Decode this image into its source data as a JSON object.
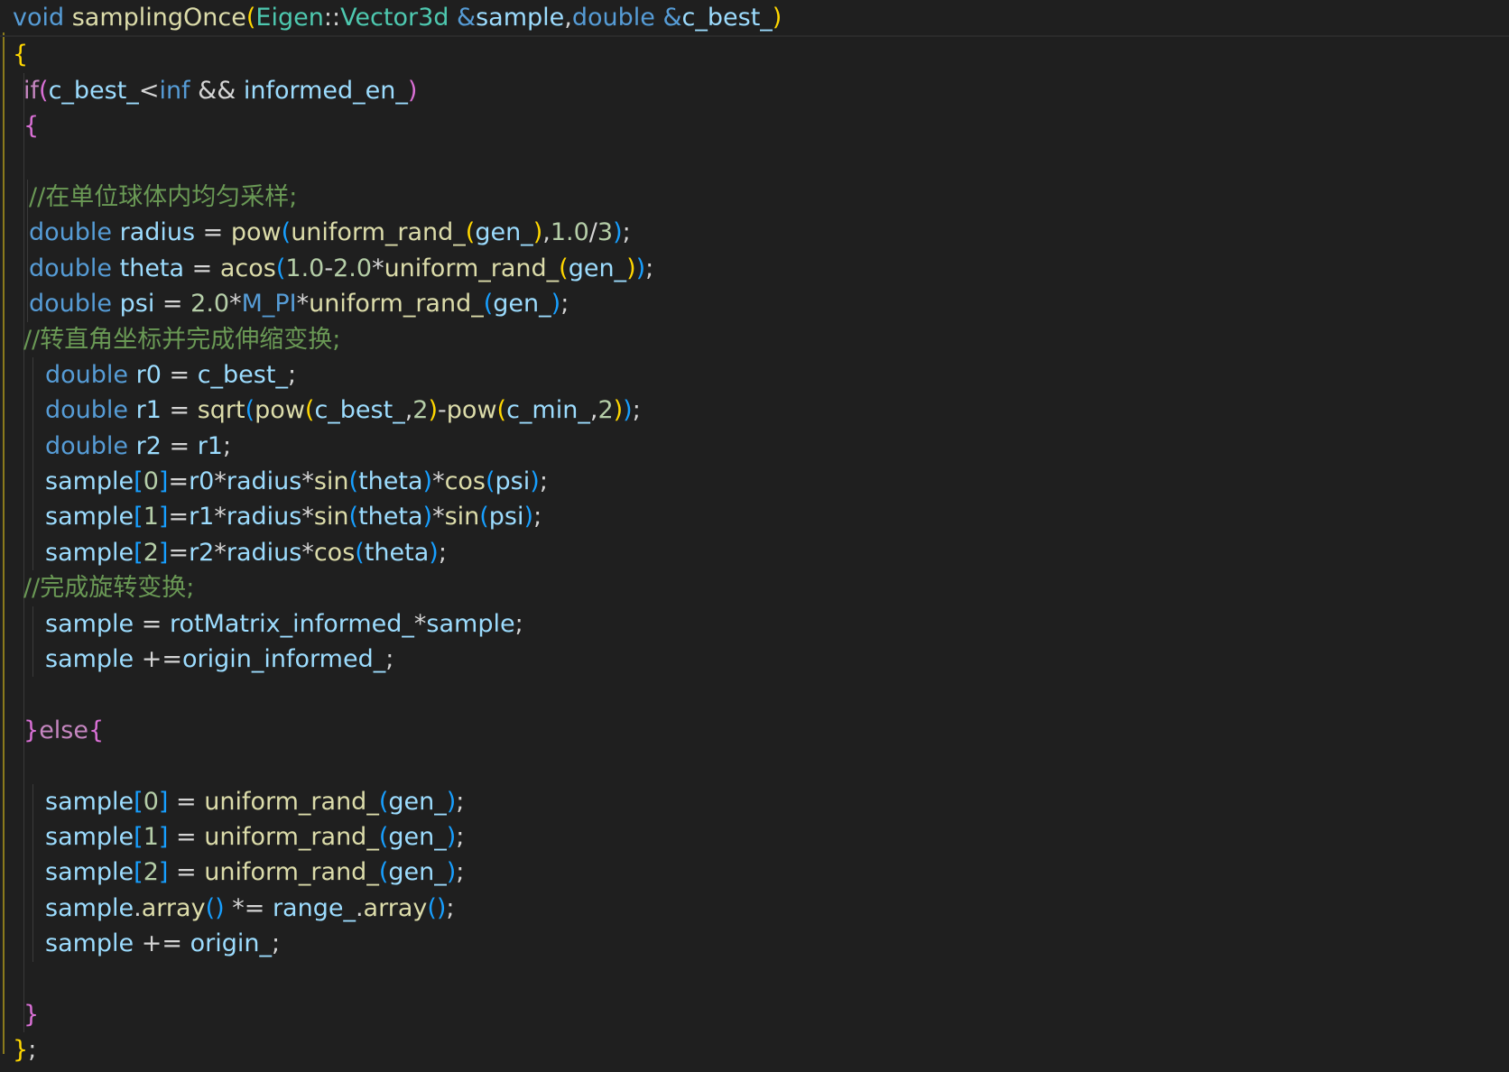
{
  "editor": {
    "language": "cpp",
    "colors": {
      "background": "#1f1f1f",
      "keyword": "#569cd6",
      "control": "#c586c0",
      "function": "#dcdcaa",
      "type": "#4ec9b0",
      "variable": "#9cdcfe",
      "number": "#b5cea8",
      "comment": "#6a9955",
      "bracket_gold": "#ffd700",
      "bracket_orchid": "#da70d6",
      "bracket_blue": "#179fff",
      "plain": "#d4d4d4"
    },
    "lines": [
      {
        "indent": 0,
        "tokens": [
          [
            "t-kw",
            "void"
          ],
          [
            "t-plain",
            " "
          ],
          [
            "t-fn",
            "samplingOnce"
          ],
          [
            "t-br1",
            "("
          ],
          [
            "t-type",
            "Eigen"
          ],
          [
            "t-plain",
            "::"
          ],
          [
            "t-type",
            "Vector3d"
          ],
          [
            "t-plain",
            " "
          ],
          [
            "t-kw",
            "&"
          ],
          [
            "t-var",
            "sample"
          ],
          [
            "t-plain",
            ","
          ],
          [
            "t-kw",
            "double"
          ],
          [
            "t-plain",
            " "
          ],
          [
            "t-kw",
            "&"
          ],
          [
            "t-var",
            "c_best_"
          ],
          [
            "t-br1",
            ")"
          ]
        ]
      },
      {
        "indent": 0,
        "tokens": [
          [
            "t-br1",
            "{"
          ]
        ]
      },
      {
        "indent": 1,
        "tokens": [
          [
            "t-ctl",
            "if"
          ],
          [
            "t-br2",
            "("
          ],
          [
            "t-var",
            "c_best_"
          ],
          [
            "t-plain",
            "<"
          ],
          [
            "t-kw",
            "inf"
          ],
          [
            "t-plain",
            " && "
          ],
          [
            "t-var",
            "informed_en_"
          ],
          [
            "t-br2",
            ")"
          ]
        ]
      },
      {
        "indent": 1,
        "tokens": [
          [
            "t-br2",
            "{"
          ]
        ]
      },
      {
        "indent": 1,
        "tokens": []
      },
      {
        "indent": 2,
        "tokens": [
          [
            "t-cmt",
            "//在单位球体内均匀采样;"
          ]
        ]
      },
      {
        "indent": 2,
        "tokens": [
          [
            "t-kw",
            "double"
          ],
          [
            "t-plain",
            " "
          ],
          [
            "t-var",
            "radius"
          ],
          [
            "t-plain",
            " = "
          ],
          [
            "t-fn",
            "pow"
          ],
          [
            "t-br3",
            "("
          ],
          [
            "t-fn",
            "uniform_rand_"
          ],
          [
            "t-br1",
            "("
          ],
          [
            "t-var",
            "gen_"
          ],
          [
            "t-br1",
            ")"
          ],
          [
            "t-plain",
            ","
          ],
          [
            "t-num",
            "1.0"
          ],
          [
            "t-plain",
            "/"
          ],
          [
            "t-num",
            "3"
          ],
          [
            "t-br3",
            ")"
          ],
          [
            "t-plain",
            ";"
          ]
        ]
      },
      {
        "indent": 2,
        "tokens": [
          [
            "t-kw",
            "double"
          ],
          [
            "t-plain",
            " "
          ],
          [
            "t-var",
            "theta"
          ],
          [
            "t-plain",
            " = "
          ],
          [
            "t-fn",
            "acos"
          ],
          [
            "t-br3",
            "("
          ],
          [
            "t-num",
            "1.0"
          ],
          [
            "t-plain",
            "-"
          ],
          [
            "t-num",
            "2.0"
          ],
          [
            "t-plain",
            "*"
          ],
          [
            "t-fn",
            "uniform_rand_"
          ],
          [
            "t-br1",
            "("
          ],
          [
            "t-var",
            "gen_"
          ],
          [
            "t-br1",
            ")"
          ],
          [
            "t-br3",
            ")"
          ],
          [
            "t-plain",
            ";"
          ]
        ]
      },
      {
        "indent": 2,
        "tokens": [
          [
            "t-kw",
            "double"
          ],
          [
            "t-plain",
            " "
          ],
          [
            "t-var",
            "psi"
          ],
          [
            "t-plain",
            " = "
          ],
          [
            "t-num",
            "2.0"
          ],
          [
            "t-plain",
            "*"
          ],
          [
            "t-macro",
            "M_PI"
          ],
          [
            "t-plain",
            "*"
          ],
          [
            "t-fn",
            "uniform_rand_"
          ],
          [
            "t-br3",
            "("
          ],
          [
            "t-var",
            "gen_"
          ],
          [
            "t-br3",
            ")"
          ],
          [
            "t-plain",
            ";"
          ]
        ]
      },
      {
        "indent": 1,
        "tokens": [
          [
            "t-cmt",
            "//转直角坐标并完成伸缩变换;"
          ]
        ]
      },
      {
        "indent": 3,
        "tokens": [
          [
            "t-kw",
            "double"
          ],
          [
            "t-plain",
            " "
          ],
          [
            "t-var",
            "r0"
          ],
          [
            "t-plain",
            " = "
          ],
          [
            "t-var",
            "c_best_"
          ],
          [
            "t-plain",
            ";"
          ]
        ]
      },
      {
        "indent": 3,
        "tokens": [
          [
            "t-kw",
            "double"
          ],
          [
            "t-plain",
            " "
          ],
          [
            "t-var",
            "r1"
          ],
          [
            "t-plain",
            " = "
          ],
          [
            "t-fn",
            "sqrt"
          ],
          [
            "t-br3",
            "("
          ],
          [
            "t-fn",
            "pow"
          ],
          [
            "t-br1",
            "("
          ],
          [
            "t-var",
            "c_best_"
          ],
          [
            "t-plain",
            ","
          ],
          [
            "t-num",
            "2"
          ],
          [
            "t-br1",
            ")"
          ],
          [
            "t-plain",
            "-"
          ],
          [
            "t-fn",
            "pow"
          ],
          [
            "t-br1",
            "("
          ],
          [
            "t-var",
            "c_min_"
          ],
          [
            "t-plain",
            ","
          ],
          [
            "t-num",
            "2"
          ],
          [
            "t-br1",
            ")"
          ],
          [
            "t-br3",
            ")"
          ],
          [
            "t-plain",
            ";"
          ]
        ]
      },
      {
        "indent": 3,
        "tokens": [
          [
            "t-kw",
            "double"
          ],
          [
            "t-plain",
            " "
          ],
          [
            "t-var",
            "r2"
          ],
          [
            "t-plain",
            " = "
          ],
          [
            "t-var",
            "r1"
          ],
          [
            "t-plain",
            ";"
          ]
        ]
      },
      {
        "indent": 3,
        "tokens": [
          [
            "t-var",
            "sample"
          ],
          [
            "t-br3",
            "["
          ],
          [
            "t-num",
            "0"
          ],
          [
            "t-br3",
            "]"
          ],
          [
            "t-plain",
            "="
          ],
          [
            "t-var",
            "r0"
          ],
          [
            "t-plain",
            "*"
          ],
          [
            "t-var",
            "radius"
          ],
          [
            "t-plain",
            "*"
          ],
          [
            "t-fn",
            "sin"
          ],
          [
            "t-br3",
            "("
          ],
          [
            "t-var",
            "theta"
          ],
          [
            "t-br3",
            ")"
          ],
          [
            "t-plain",
            "*"
          ],
          [
            "t-fn",
            "cos"
          ],
          [
            "t-br3",
            "("
          ],
          [
            "t-var",
            "psi"
          ],
          [
            "t-br3",
            ")"
          ],
          [
            "t-plain",
            ";"
          ]
        ]
      },
      {
        "indent": 3,
        "tokens": [
          [
            "t-var",
            "sample"
          ],
          [
            "t-br3",
            "["
          ],
          [
            "t-num",
            "1"
          ],
          [
            "t-br3",
            "]"
          ],
          [
            "t-plain",
            "="
          ],
          [
            "t-var",
            "r1"
          ],
          [
            "t-plain",
            "*"
          ],
          [
            "t-var",
            "radius"
          ],
          [
            "t-plain",
            "*"
          ],
          [
            "t-fn",
            "sin"
          ],
          [
            "t-br3",
            "("
          ],
          [
            "t-var",
            "theta"
          ],
          [
            "t-br3",
            ")"
          ],
          [
            "t-plain",
            "*"
          ],
          [
            "t-fn",
            "sin"
          ],
          [
            "t-br3",
            "("
          ],
          [
            "t-var",
            "psi"
          ],
          [
            "t-br3",
            ")"
          ],
          [
            "t-plain",
            ";"
          ]
        ]
      },
      {
        "indent": 3,
        "tokens": [
          [
            "t-var",
            "sample"
          ],
          [
            "t-br3",
            "["
          ],
          [
            "t-num",
            "2"
          ],
          [
            "t-br3",
            "]"
          ],
          [
            "t-plain",
            "="
          ],
          [
            "t-var",
            "r2"
          ],
          [
            "t-plain",
            "*"
          ],
          [
            "t-var",
            "radius"
          ],
          [
            "t-plain",
            "*"
          ],
          [
            "t-fn",
            "cos"
          ],
          [
            "t-br3",
            "("
          ],
          [
            "t-var",
            "theta"
          ],
          [
            "t-br3",
            ")"
          ],
          [
            "t-plain",
            ";"
          ]
        ]
      },
      {
        "indent": 1,
        "tokens": [
          [
            "t-cmt",
            "//完成旋转变换;"
          ]
        ]
      },
      {
        "indent": 3,
        "tokens": [
          [
            "t-var",
            "sample"
          ],
          [
            "t-plain",
            " = "
          ],
          [
            "t-var",
            "rotMatrix_informed_"
          ],
          [
            "t-plain",
            "*"
          ],
          [
            "t-var",
            "sample"
          ],
          [
            "t-plain",
            ";"
          ]
        ]
      },
      {
        "indent": 3,
        "tokens": [
          [
            "t-var",
            "sample"
          ],
          [
            "t-plain",
            " +="
          ],
          [
            "t-var",
            "origin_informed_"
          ],
          [
            "t-plain",
            ";"
          ]
        ]
      },
      {
        "indent": 1,
        "tokens": []
      },
      {
        "indent": 1,
        "tokens": [
          [
            "t-br2",
            "}"
          ],
          [
            "t-ctl",
            "else"
          ],
          [
            "t-br2",
            "{"
          ]
        ]
      },
      {
        "indent": 1,
        "tokens": []
      },
      {
        "indent": 3,
        "tokens": [
          [
            "t-var",
            "sample"
          ],
          [
            "t-br3",
            "["
          ],
          [
            "t-num",
            "0"
          ],
          [
            "t-br3",
            "]"
          ],
          [
            "t-plain",
            " = "
          ],
          [
            "t-fn",
            "uniform_rand_"
          ],
          [
            "t-br3",
            "("
          ],
          [
            "t-var",
            "gen_"
          ],
          [
            "t-br3",
            ")"
          ],
          [
            "t-plain",
            ";"
          ]
        ]
      },
      {
        "indent": 3,
        "tokens": [
          [
            "t-var",
            "sample"
          ],
          [
            "t-br3",
            "["
          ],
          [
            "t-num",
            "1"
          ],
          [
            "t-br3",
            "]"
          ],
          [
            "t-plain",
            " = "
          ],
          [
            "t-fn",
            "uniform_rand_"
          ],
          [
            "t-br3",
            "("
          ],
          [
            "t-var",
            "gen_"
          ],
          [
            "t-br3",
            ")"
          ],
          [
            "t-plain",
            ";"
          ]
        ]
      },
      {
        "indent": 3,
        "tokens": [
          [
            "t-var",
            "sample"
          ],
          [
            "t-br3",
            "["
          ],
          [
            "t-num",
            "2"
          ],
          [
            "t-br3",
            "]"
          ],
          [
            "t-plain",
            " = "
          ],
          [
            "t-fn",
            "uniform_rand_"
          ],
          [
            "t-br3",
            "("
          ],
          [
            "t-var",
            "gen_"
          ],
          [
            "t-br3",
            ")"
          ],
          [
            "t-plain",
            ";"
          ]
        ]
      },
      {
        "indent": 3,
        "tokens": [
          [
            "t-var",
            "sample"
          ],
          [
            "t-plain",
            "."
          ],
          [
            "t-fn",
            "array"
          ],
          [
            "t-br3",
            "()"
          ],
          [
            "t-plain",
            " *= "
          ],
          [
            "t-var",
            "range_"
          ],
          [
            "t-plain",
            "."
          ],
          [
            "t-fn",
            "array"
          ],
          [
            "t-br3",
            "()"
          ],
          [
            "t-plain",
            ";"
          ]
        ]
      },
      {
        "indent": 3,
        "tokens": [
          [
            "t-var",
            "sample"
          ],
          [
            "t-plain",
            " += "
          ],
          [
            "t-var",
            "origin_"
          ],
          [
            "t-plain",
            ";"
          ]
        ]
      },
      {
        "indent": 1,
        "tokens": []
      },
      {
        "indent": 1,
        "tokens": [
          [
            "t-br2",
            "}"
          ]
        ]
      },
      {
        "indent": 0,
        "tokens": [
          [
            "t-br1",
            "}"
          ],
          [
            "t-plain",
            ";"
          ]
        ]
      }
    ]
  }
}
